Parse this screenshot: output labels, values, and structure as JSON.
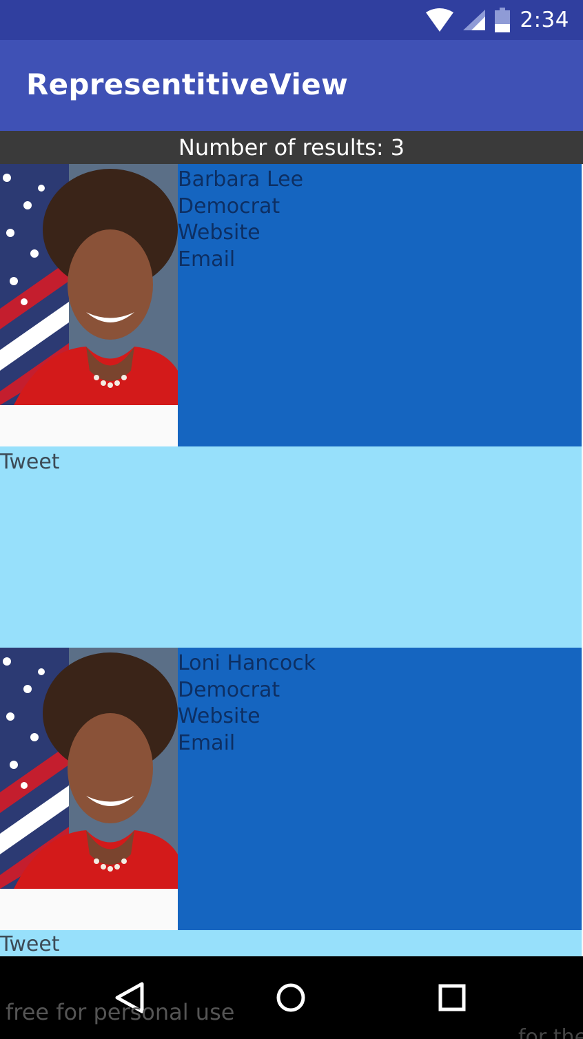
{
  "status_bar": {
    "time": "2:34",
    "icons": [
      "wifi-icon",
      "signal-icon",
      "battery-icon"
    ]
  },
  "app_bar": {
    "title": "RepresentitiveView"
  },
  "results": {
    "header": "Number of results: 3"
  },
  "representatives": [
    {
      "name": "Barbara Lee",
      "party": "Democrat",
      "website_label": "Website",
      "email_label": "Email",
      "tweet_label": "Tweet"
    },
    {
      "name": "Loni Hancock",
      "party": "Democrat",
      "website_label": "Website",
      "email_label": "Email",
      "tweet_label": "Tweet"
    }
  ],
  "nav_bar": {
    "buttons": [
      "back-icon",
      "home-icon",
      "recents-icon"
    ]
  },
  "watermark": {
    "text": "free for personal use",
    "right_text": "for the"
  },
  "colors": {
    "status_bar": "#303f9f",
    "app_bar": "#3f51b5",
    "results_header": "#3a3a3a",
    "details_bg": "#1565c0",
    "tweet_bg": "#97e0fb"
  }
}
